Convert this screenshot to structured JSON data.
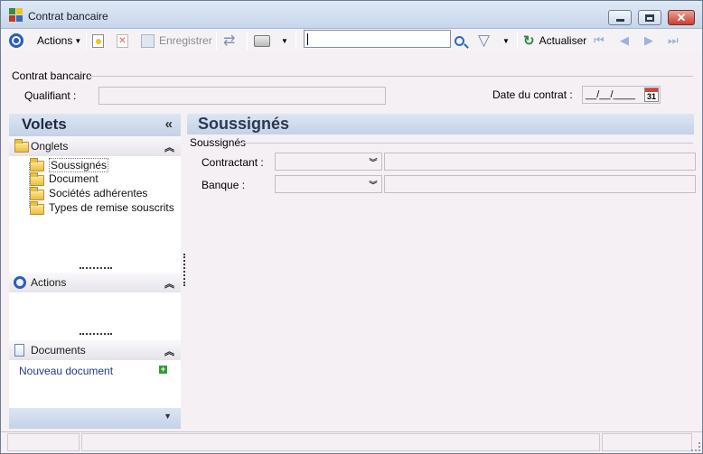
{
  "window": {
    "title": "Contrat bancaire"
  },
  "toolbar": {
    "actions_label": "Actions",
    "save_label": "Enregistrer",
    "refresh_label": "Actualiser",
    "search": {
      "value": "",
      "placeholder": ""
    }
  },
  "contract": {
    "group_title": "Contrat bancaire",
    "qualifier_label": "Qualifiant :",
    "qualifier_value": "",
    "date_label": "Date du contrat :",
    "date_value": "__/__/____"
  },
  "left_pane": {
    "title": "Volets",
    "tabs_section": {
      "title": "Onglets",
      "items": [
        {
          "label": "Soussignés",
          "selected": true
        },
        {
          "label": "Document"
        },
        {
          "label": "Sociétés adhérentes"
        },
        {
          "label": "Types de remise souscrits"
        }
      ]
    },
    "actions_section": {
      "title": "Actions"
    },
    "documents_section": {
      "title": "Documents",
      "new_link": "Nouveau document"
    }
  },
  "main": {
    "title": "Soussignés",
    "group_title": "Soussignés",
    "fields": [
      {
        "label": "Contractant :",
        "value": "",
        "detail": ""
      },
      {
        "label": "Banque :",
        "value": "",
        "detail": ""
      }
    ]
  },
  "icons": {
    "app": "app-logo-icon",
    "calendar_day": "31"
  }
}
